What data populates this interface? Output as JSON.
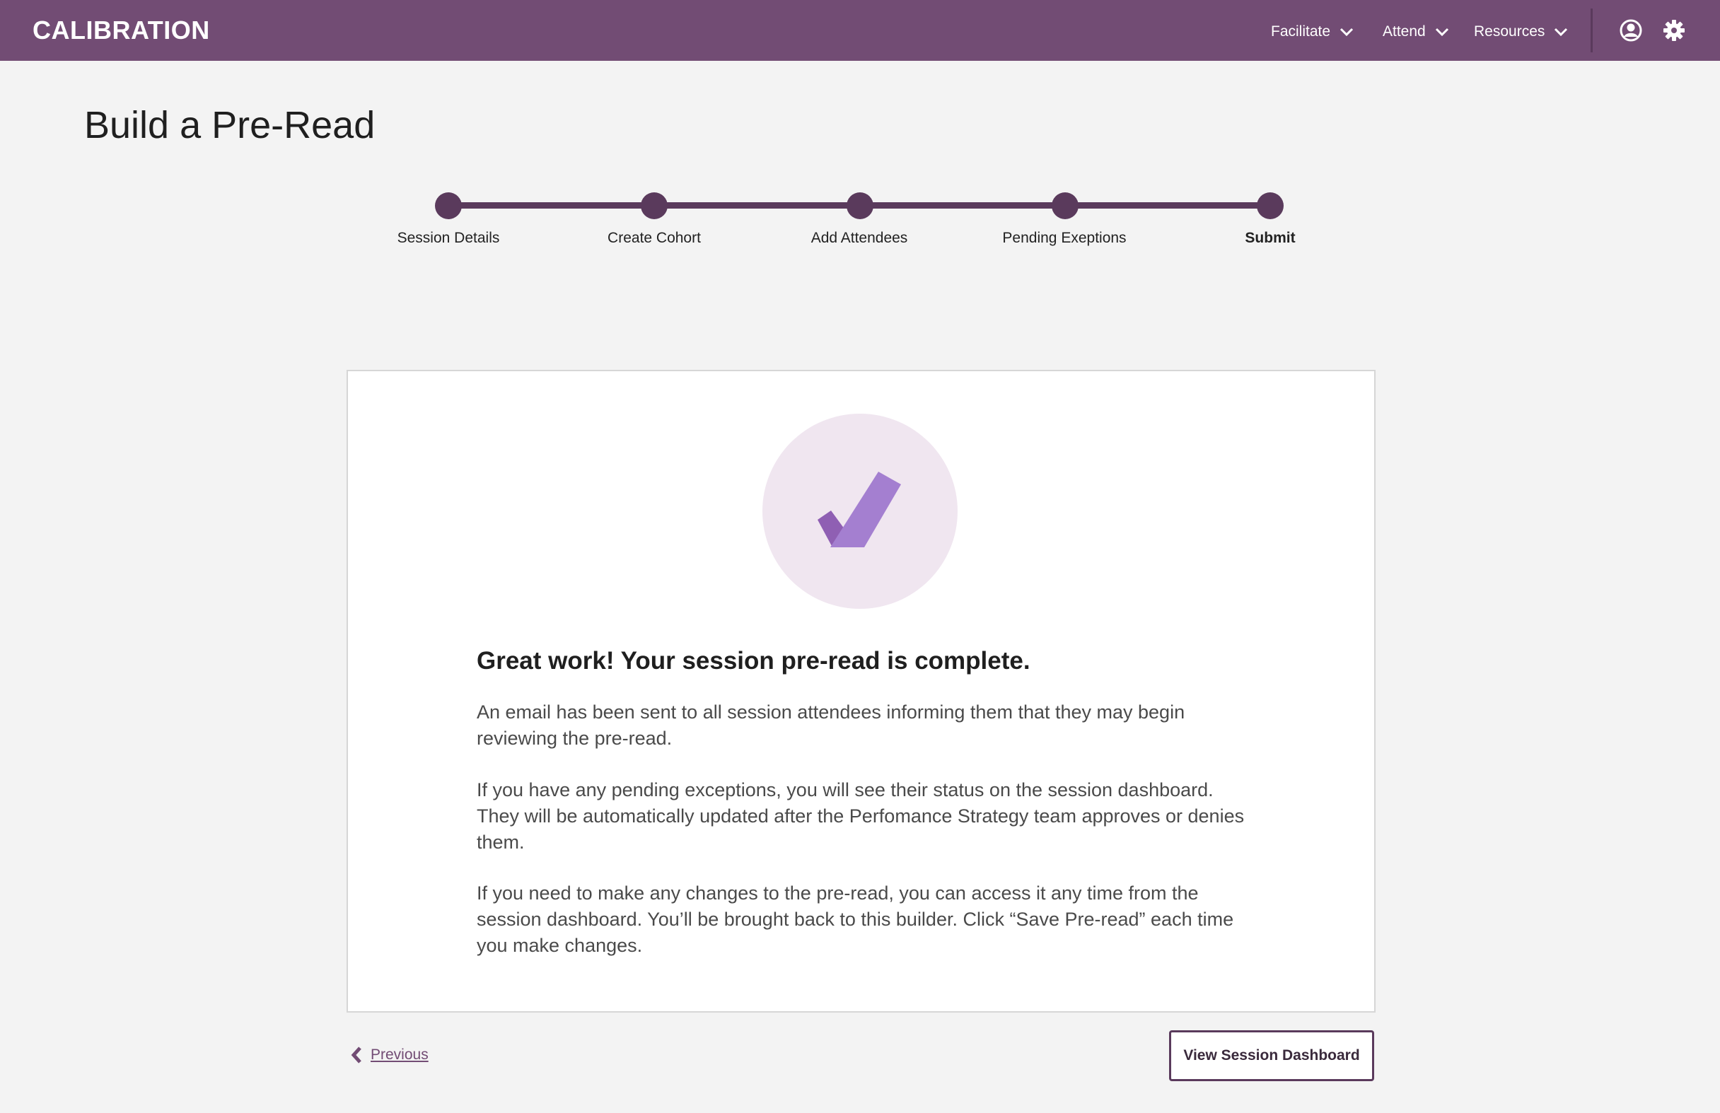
{
  "header": {
    "brand": "CALIBRATION",
    "nav": [
      {
        "label": "Facilitate",
        "icon": "chevron-down-icon"
      },
      {
        "label": "Attend",
        "icon": "chevron-down-icon"
      },
      {
        "label": "Resources",
        "icon": "chevron-down-icon"
      }
    ],
    "icons": [
      "user-profile-icon",
      "gear-icon"
    ],
    "colors": {
      "bar": "#724c74",
      "accent": "#5a3a5c"
    }
  },
  "page": {
    "title": "Build a Pre-Read"
  },
  "stepper": {
    "steps": [
      {
        "label": "Session Details",
        "active": false
      },
      {
        "label": "Create Cohort",
        "active": false
      },
      {
        "label": "Add Attendees",
        "active": false
      },
      {
        "label": "Pending Exeptions",
        "active": false
      },
      {
        "label": "Submit",
        "active": true
      }
    ]
  },
  "card": {
    "icon": "checkmark-icon",
    "headline": "Great work! Your session pre-read is complete.",
    "paragraphs": [
      "An email has been sent to all session attendees informing them that they may begin reviewing the pre-read.",
      "If you have any pending exceptions, you will see their status on the session dashboard. They will be automatically updated after the Perfomance Strategy team approves or denies them.",
      "If you need to make any changes to the pre-read, you can access it any time from the session dashboard. You’ll be brought back to this builder. Click “Save Pre-read” each time you make changes."
    ]
  },
  "footer": {
    "previous_label": "Previous",
    "dashboard_button_label": "View Session Dashboard"
  }
}
